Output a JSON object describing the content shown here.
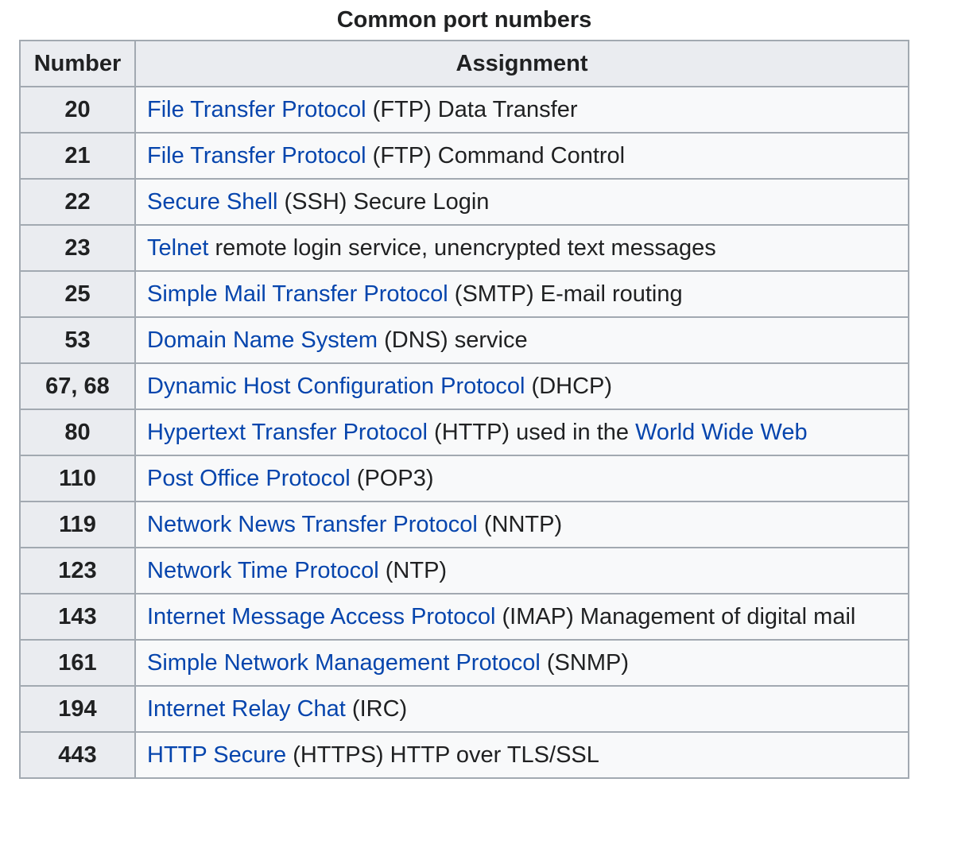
{
  "table": {
    "caption": "Common port numbers",
    "headers": [
      "Number",
      "Assignment"
    ],
    "rows": [
      {
        "number": "20",
        "parts": [
          {
            "text": "File Transfer Protocol",
            "link": true
          },
          {
            "text": " (FTP) Data Transfer",
            "link": false
          }
        ]
      },
      {
        "number": "21",
        "parts": [
          {
            "text": "File Transfer Protocol",
            "link": true
          },
          {
            "text": " (FTP) Command Control",
            "link": false
          }
        ]
      },
      {
        "number": "22",
        "parts": [
          {
            "text": "Secure Shell",
            "link": true
          },
          {
            "text": " (SSH) Secure Login",
            "link": false
          }
        ]
      },
      {
        "number": "23",
        "parts": [
          {
            "text": "Telnet",
            "link": true
          },
          {
            "text": " remote login service, unencrypted text messages",
            "link": false
          }
        ]
      },
      {
        "number": "25",
        "parts": [
          {
            "text": "Simple Mail Transfer Protocol",
            "link": true
          },
          {
            "text": " (SMTP) E-mail routing",
            "link": false
          }
        ]
      },
      {
        "number": "53",
        "parts": [
          {
            "text": "Domain Name System",
            "link": true
          },
          {
            "text": " (DNS) service",
            "link": false
          }
        ]
      },
      {
        "number": "67, 68",
        "parts": [
          {
            "text": "Dynamic Host Configuration Protocol",
            "link": true
          },
          {
            "text": " (DHCP)",
            "link": false
          }
        ]
      },
      {
        "number": "80",
        "parts": [
          {
            "text": "Hypertext Transfer Protocol",
            "link": true
          },
          {
            "text": " (HTTP) used in the ",
            "link": false
          },
          {
            "text": "World Wide Web",
            "link": true
          }
        ]
      },
      {
        "number": "110",
        "parts": [
          {
            "text": "Post Office Protocol",
            "link": true
          },
          {
            "text": " (POP3)",
            "link": false
          }
        ]
      },
      {
        "number": "119",
        "parts": [
          {
            "text": "Network News Transfer Protocol",
            "link": true
          },
          {
            "text": " (NNTP)",
            "link": false
          }
        ]
      },
      {
        "number": "123",
        "parts": [
          {
            "text": "Network Time Protocol",
            "link": true
          },
          {
            "text": " (NTP)",
            "link": false
          }
        ]
      },
      {
        "number": "143",
        "parts": [
          {
            "text": "Internet Message Access Protocol",
            "link": true
          },
          {
            "text": " (IMAP) Management of digital mail",
            "link": false
          }
        ]
      },
      {
        "number": "161",
        "parts": [
          {
            "text": "Simple Network Management Protocol",
            "link": true
          },
          {
            "text": " (SNMP)",
            "link": false
          }
        ]
      },
      {
        "number": "194",
        "parts": [
          {
            "text": "Internet Relay Chat",
            "link": true
          },
          {
            "text": " (IRC)",
            "link": false
          }
        ]
      },
      {
        "number": "443",
        "parts": [
          {
            "text": "HTTP Secure",
            "link": true
          },
          {
            "text": " (HTTPS) HTTP over TLS/SSL",
            "link": false
          }
        ]
      }
    ]
  },
  "colors": {
    "link": "#0645ad",
    "text": "#202122",
    "header_bg": "#eaecf0",
    "cell_bg": "#f8f9fa",
    "border": "#a2a9b1"
  }
}
